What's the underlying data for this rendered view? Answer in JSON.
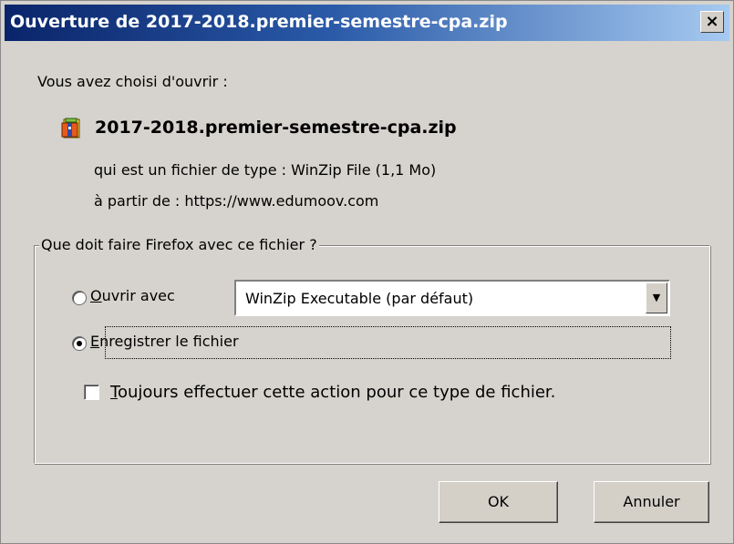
{
  "window": {
    "title": "Ouverture de 2017-2018.premier-semestre-cpa.zip",
    "close_label": "×"
  },
  "body": {
    "intro": "Vous avez choisi d'ouvrir :",
    "file_icon": "winzip-file-icon",
    "filename": "2017-2018.premier-semestre-cpa.zip",
    "type_line": "qui est un fichier de type :  WinZip File (1,1 Mo)",
    "from_line": "à partir de :  https://www.edumoov.com"
  },
  "group": {
    "legend": "Que doit faire Firefox avec ce fichier ?",
    "open_with": {
      "label_first": "O",
      "label_rest": "uvrir avec",
      "checked": false
    },
    "app_select": {
      "value": "WinZip Executable (par défaut)",
      "arrow_icon": "chevron-down-icon"
    },
    "save_file": {
      "label_first": "E",
      "label_rest": "nregistrer le fichier",
      "checked": true
    },
    "always": {
      "label_first": "T",
      "label_rest": "oujours effectuer cette action pour ce type de fichier.",
      "checked": false
    }
  },
  "buttons": {
    "ok": "OK",
    "cancel": "Annuler"
  }
}
